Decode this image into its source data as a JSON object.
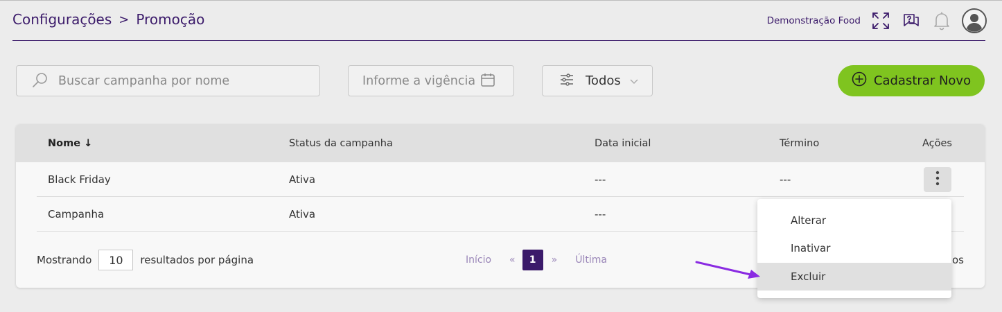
{
  "breadcrumb": {
    "parent": "Configurações",
    "separator": ">",
    "current": "Promoção"
  },
  "header": {
    "company": "Demonstração Food",
    "icons": [
      "expand-icon",
      "help-icon",
      "bell-icon",
      "avatar-icon"
    ]
  },
  "filters": {
    "search_placeholder": "Buscar campanha por nome",
    "date_placeholder": "Informe a vigência",
    "status_value": "Todos"
  },
  "actions": {
    "new_button": "Cadastrar Novo"
  },
  "colors": {
    "brand": "#3b1a6a",
    "accent_green": "#7fc41f"
  },
  "table": {
    "columns": [
      "Nome",
      "Status da campanha",
      "Data inicial",
      "Término",
      "Ações"
    ],
    "sort_indicator": "↓",
    "rows": [
      {
        "name": "Black Friday",
        "status": "Ativa",
        "start": "---",
        "end": "---"
      },
      {
        "name": "Campanha",
        "status": "Ativa",
        "start": "---",
        "end": ""
      }
    ]
  },
  "pagination": {
    "showing_label": "Mostrando",
    "per_page": "10",
    "per_page_label": "resultados por página",
    "first": "Início",
    "prev": "«",
    "current_page": "1",
    "next": "»",
    "last": "Última",
    "tail_text": "os"
  },
  "context_menu": {
    "items": [
      "Alterar",
      "Inativar",
      "Excluir"
    ],
    "highlighted": "Excluir"
  }
}
